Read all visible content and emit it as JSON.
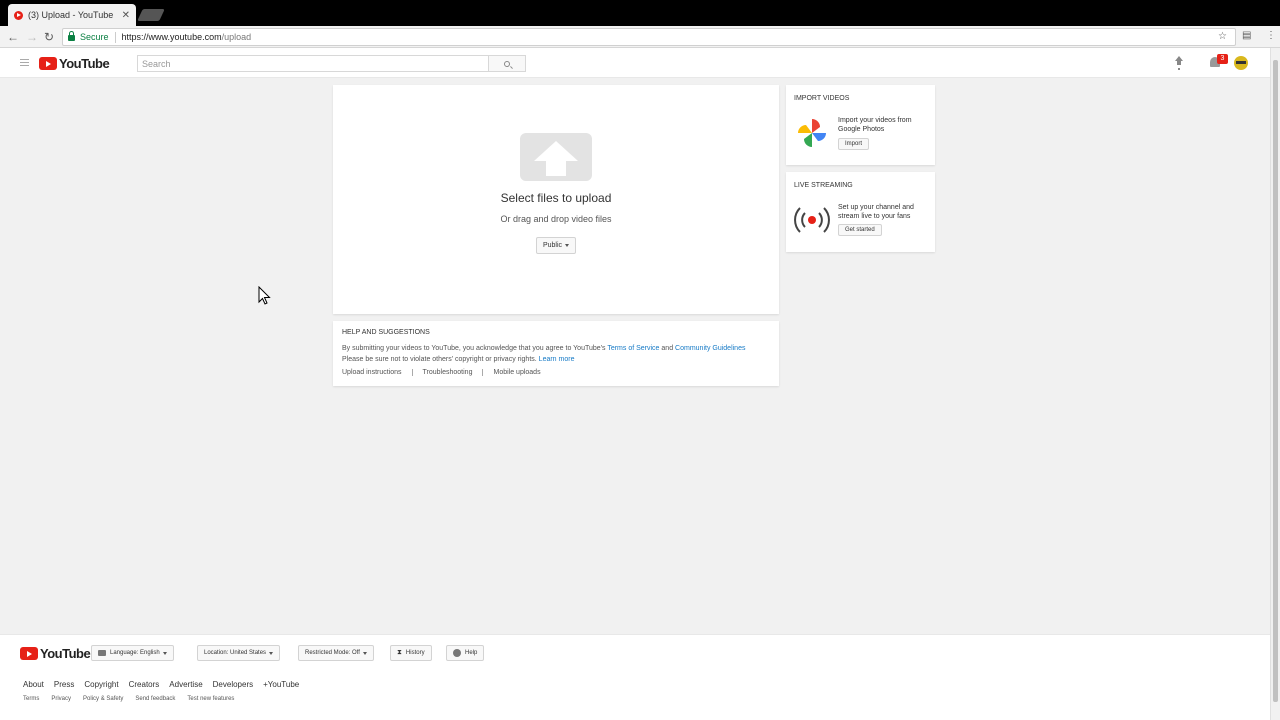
{
  "browser": {
    "tab_title": "(3) Upload - YouTube",
    "tab_close": "✕",
    "secure_label": "Secure",
    "url_host": "https://www.youtube.com",
    "url_path": "/upload"
  },
  "header": {
    "logo_text": "YouTube",
    "search_placeholder": "Search",
    "notification_count": "3"
  },
  "upload": {
    "title": "Select files to upload",
    "subtitle": "Or drag and drop video files",
    "privacy_value": "Public"
  },
  "help": {
    "title": "HELP AND SUGGESTIONS",
    "text_1": "By submitting your videos to YouTube, you acknowledge that you agree to YouTube's",
    "terms_link": "Terms of Service",
    "and": "and",
    "guidelines_link": "Community Guidelines",
    "text_2": "Please be sure not to violate others' copyright or privacy rights.",
    "learn_more": "Learn more",
    "links": [
      "Upload instructions",
      "Troubleshooting",
      "Mobile uploads"
    ]
  },
  "import": {
    "title": "IMPORT VIDEOS",
    "desc": "Import your videos from Google Photos",
    "button": "Import"
  },
  "live": {
    "title": "LIVE STREAMING",
    "desc": "Set up your channel and stream live to your fans",
    "button": "Get started"
  },
  "footer": {
    "logo_text": "YouTube",
    "language": "Language: English",
    "location": "Location: United States",
    "restricted": "Restricted Mode: Off",
    "history": "History",
    "help": "Help",
    "links_primary": [
      "About",
      "Press",
      "Copyright",
      "Creators",
      "Advertise",
      "Developers",
      "+YouTube"
    ],
    "links_secondary": [
      "Terms",
      "Privacy",
      "Policy & Safety",
      "Send feedback",
      "Test new features"
    ]
  },
  "colors": {
    "brand_red": "#e62117",
    "link_blue": "#167ac6",
    "secure_green": "#0b8043"
  }
}
